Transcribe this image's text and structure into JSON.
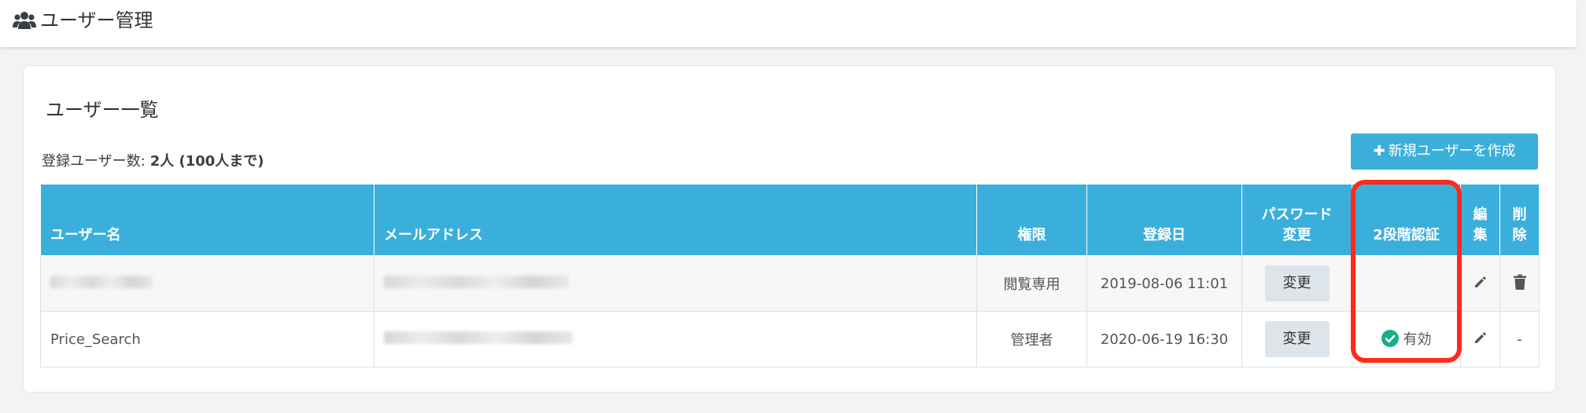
{
  "header": {
    "icon": "users-icon",
    "title": "ユーザー管理"
  },
  "card": {
    "title": "ユーザー一覧",
    "count_label": "登録ユーザー数:",
    "count_value": "2人 (100人まで)",
    "create_button": "新規ユーザーを作成"
  },
  "table": {
    "headers": {
      "username": "ユーザー名",
      "email": "メールアドレス",
      "role": "権限",
      "registered": "登録日",
      "password_line1": "パスワード",
      "password_line2": "変更",
      "twofa": "2段階認証",
      "edit_line1": "編",
      "edit_line2": "集",
      "delete_line1": "削",
      "delete_line2": "除"
    },
    "rows": [
      {
        "username": "",
        "email": "",
        "role": "閲覧専用",
        "registered": "2019-08-06 11:01",
        "change_label": "変更",
        "twofa_status": "",
        "delete": "trash-icon"
      },
      {
        "username": "Price_Search",
        "email": "",
        "role": "管理者",
        "registered": "2020-06-19 16:30",
        "change_label": "変更",
        "twofa_status": "有効",
        "delete": "-"
      }
    ]
  },
  "colors": {
    "accent": "#3bafdb",
    "highlight": "#ff2a1a",
    "success": "#1aae8a"
  }
}
